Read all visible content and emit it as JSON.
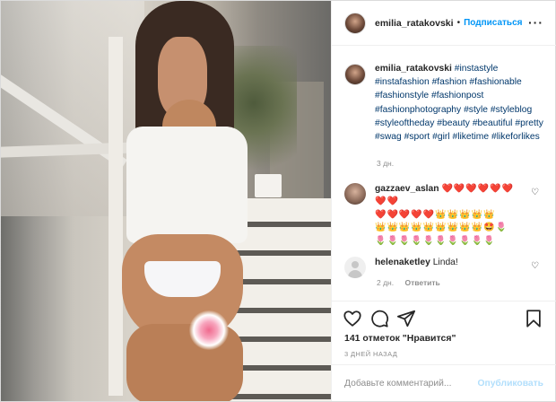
{
  "header": {
    "username": "emilia_ratakovski",
    "separator": "•",
    "follow_label": "Подписаться",
    "more_label": "···"
  },
  "caption": {
    "username": "emilia_ratakovski",
    "hashtags": [
      "#instastyle",
      "#instafashion",
      "#fashion",
      "#fashionable",
      "#fashionstyle",
      "#fashionpost",
      "#fashionphotography",
      "#style",
      "#styleblog",
      "#styleoftheday",
      "#beauty",
      "#beautiful",
      "#pretty",
      "#swag",
      "#sport",
      "#girl",
      "#liketime",
      "#likeforlikes"
    ],
    "time": "3 дн."
  },
  "comments": [
    {
      "username": "gazzaev_aslan",
      "emoji_line1": "❤️❤️❤️❤️❤️❤️❤️❤️",
      "emoji_line2": "❤️❤️❤️❤️❤️👑👑👑👑👑",
      "emoji_line3": "👑👑👑👑👑👑👑👑👑🤩🌷",
      "emoji_line4": "🌷🌷🌷🌷🌷🌷🌷🌷🌷🌷"
    },
    {
      "username": "helenaketley",
      "text": "Linda!",
      "time": "2 дн.",
      "reply_label": "Ответить"
    }
  ],
  "likes_text": "141 отметок \"Нравится\"",
  "post_time": "3 ДНЕЙ НАЗАД",
  "comment_box": {
    "placeholder": "Добавьте комментарий...",
    "publish_label": "Опубликовать"
  },
  "icons": {
    "like": "heart-icon",
    "comment": "comment-icon",
    "share": "share-icon",
    "save": "bookmark-icon",
    "comment_like": "small-heart-icon"
  }
}
